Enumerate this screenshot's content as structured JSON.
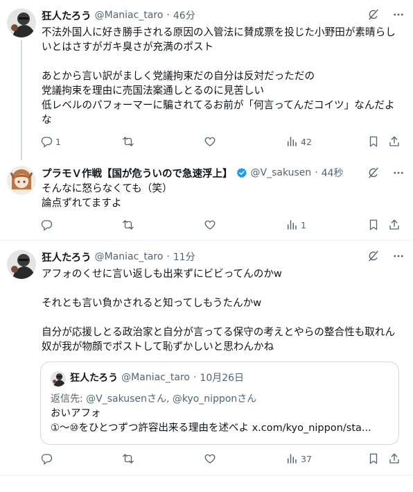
{
  "tweets": [
    {
      "name": "狂人たろう",
      "handle": "@Maniac_taro",
      "dot": "·",
      "time": "46分",
      "text": "不法外国人に好き勝手される原因の入管法に賛成票を投じた小野田が素晴らしいとはさすがガキ臭さが充満のポスト\n\nあとから言い訳がましく党議拘束だの自分は反対だっただの\n党議拘束を理由に売国法案通しとるのに見苦しい\n低レベルのパフォーマーに騙されてるお前が「何言ってんだコイツ」なんだよな",
      "replies": "1",
      "retweets": "",
      "likes": "",
      "views": "42"
    },
    {
      "name": "プラモＶ作戦【国が危ういので急速浮上】",
      "handle": "@V_sakusen",
      "dot": "·",
      "time": "44秒",
      "text": "そんなに怒らなくても（笑）\n論点ずれてますよ",
      "replies": "",
      "retweets": "",
      "likes": "",
      "views": "1"
    },
    {
      "name": "狂人たろう",
      "handle": "@Maniac_taro",
      "dot": "·",
      "time": "11分",
      "text": "アフォのくせに言い返しも出来ずにビビってんのかw\n\nそれとも言い負かされると知ってしもうたんかw\n\n自分が応援しとる政治家と自分が言ってる保守の考えとやらの整合性も取れん奴が我が物顔でポストして恥ずかしいと思わんかね",
      "replies": "",
      "retweets": "",
      "likes": "",
      "views": "37",
      "quote": {
        "name": "狂人たろう",
        "handle": "@Maniac_taro",
        "dot": "·",
        "date": "10月26日",
        "reply_prefix": "返信先: ",
        "reply_mentions": "@V_sakusenさん, @kyo_nipponさん",
        "text": "おいアフォ\n①～⑩をひとつずつ許容出来る理由を述べよ x.com/kyo_nippon/sta..."
      }
    }
  ],
  "colors": {
    "text": "#0f1419",
    "muted": "#536471",
    "verified": "#1d9bf0",
    "border": "#cfd9de"
  },
  "icons": [
    "grok-icon",
    "more-icon",
    "reply-icon",
    "retweet-icon",
    "like-icon",
    "views-icon",
    "bookmark-icon",
    "share-icon",
    "verified-icon"
  ]
}
